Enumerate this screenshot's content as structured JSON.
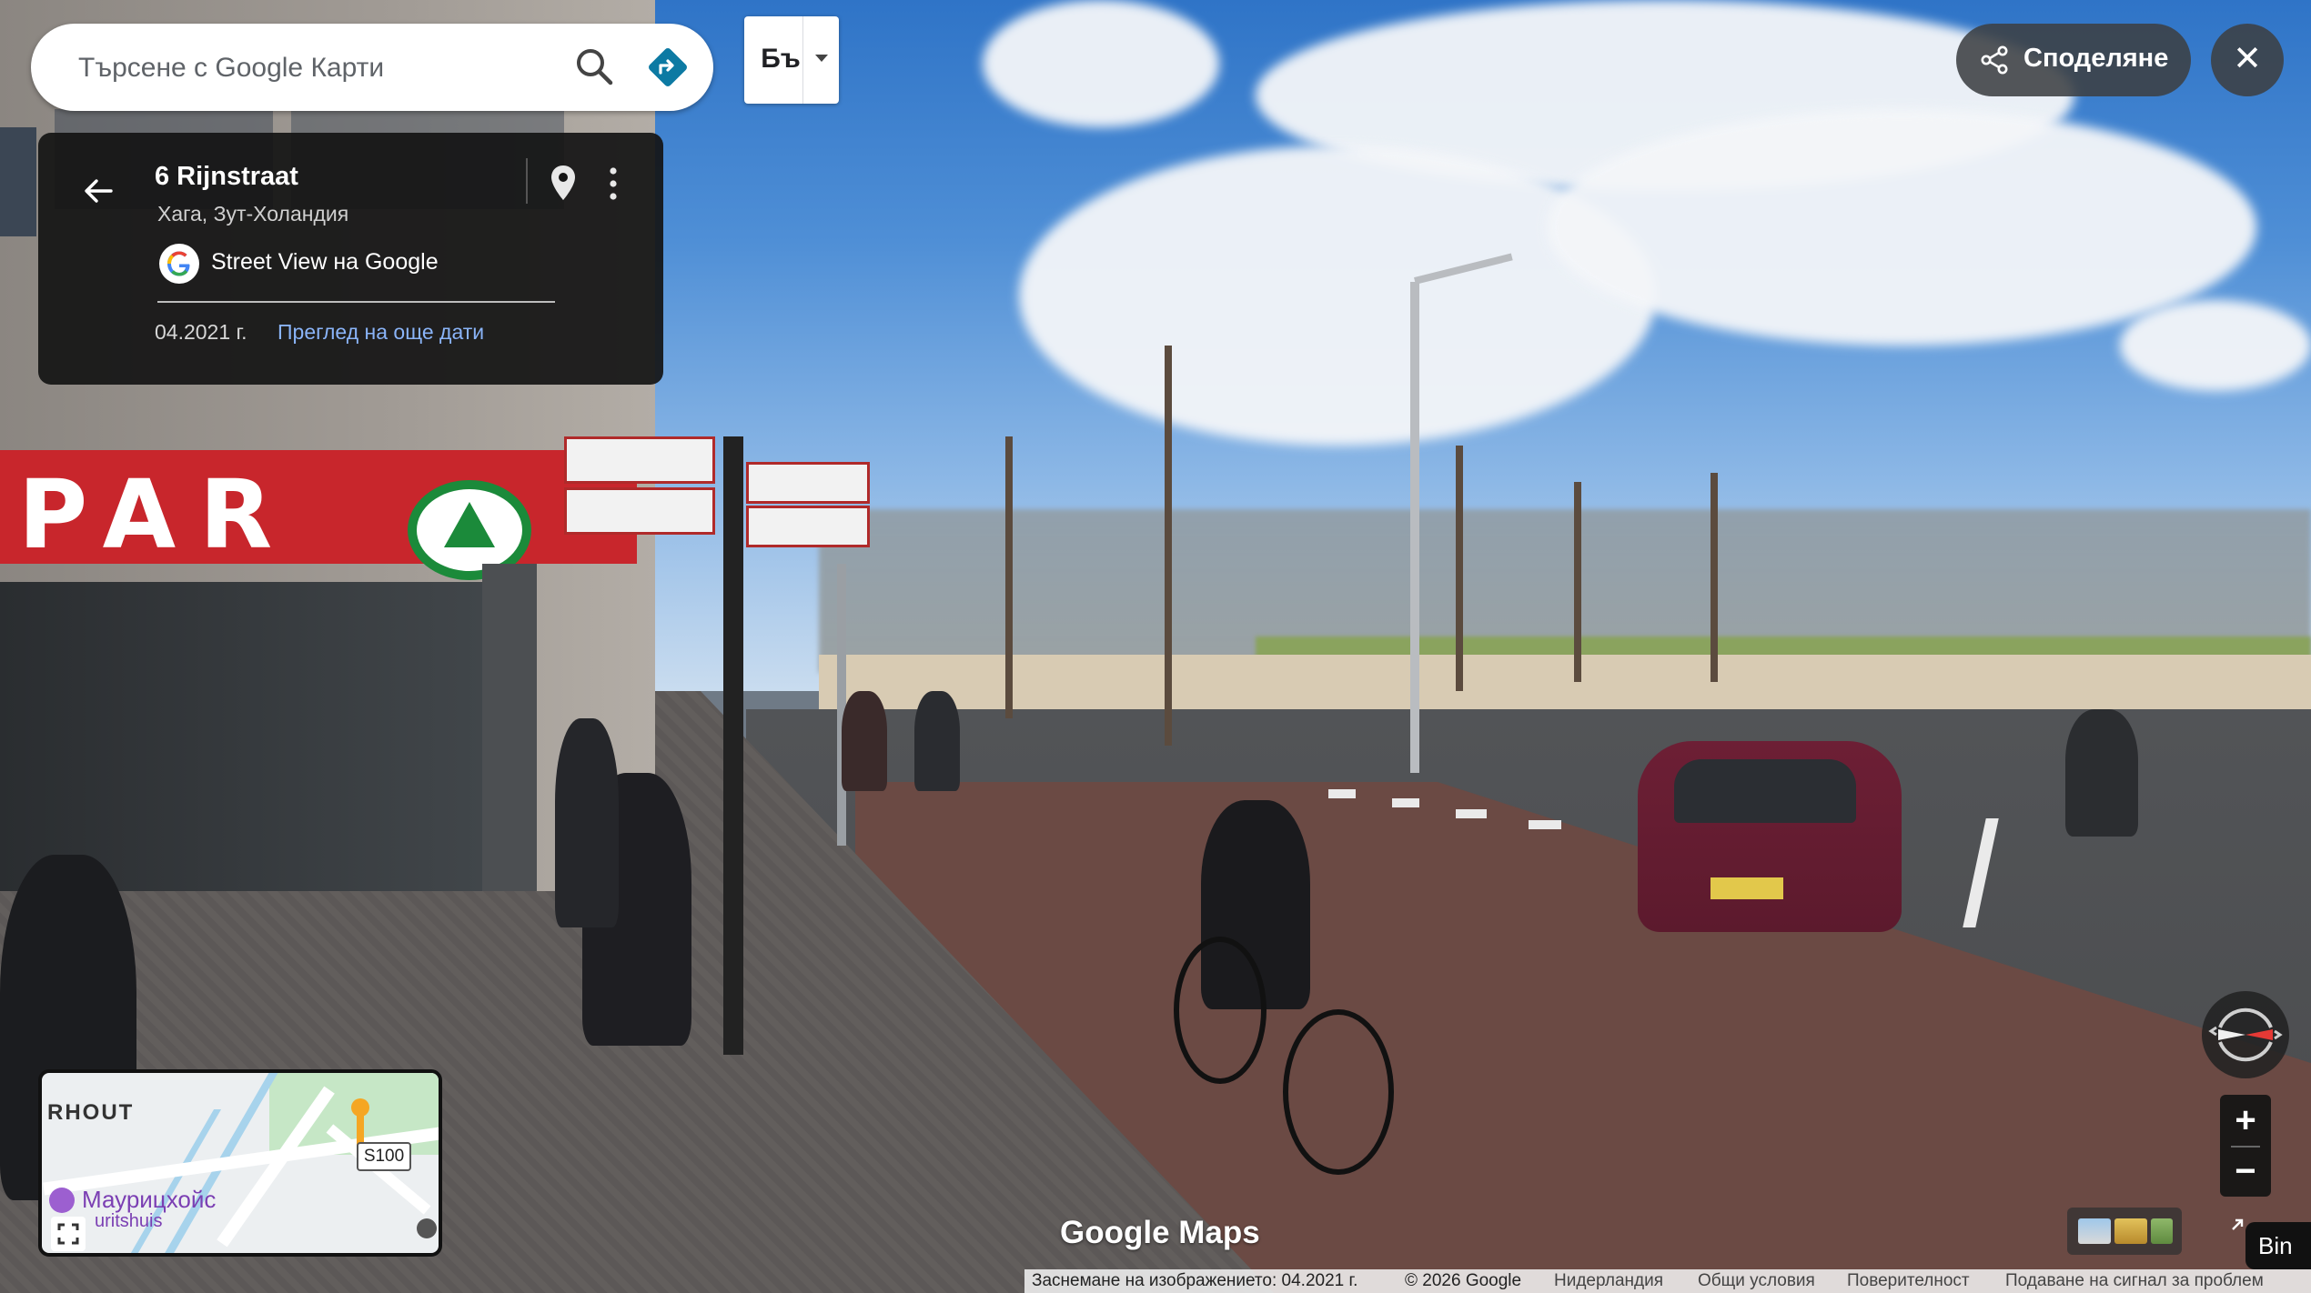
{
  "search": {
    "placeholder": "Търсене с Google Карти",
    "search_icon": "search-icon",
    "directions_icon": "directions-icon"
  },
  "language": {
    "label": "Бъ"
  },
  "panel": {
    "title": "6 Rijnstraat",
    "subtitle": "Хага, Зут-Холандия",
    "source_label": "Street View на Google",
    "date": "04.2021 г.",
    "more_dates": "Преглед на още дати"
  },
  "share": {
    "label": "Споделяне"
  },
  "close": {
    "label": "✕"
  },
  "zoom": {
    "in": "+",
    "out": "−"
  },
  "minimap": {
    "label_top": "RHOUT",
    "poi_name": "Маурицхойс",
    "poi_sub": "uritshuis",
    "route": "S100"
  },
  "branding": {
    "logo": "Google Maps"
  },
  "scene": {
    "shop_sign": "PAR"
  },
  "footer": {
    "capture": "Заснемане на изображението: 04.2021 г.",
    "copyright": "© 2026 Google",
    "country": "Нидерландия",
    "terms": "Общи условия",
    "privacy": "Поверителност",
    "report": "Подаване на сигнал за проблем"
  },
  "bing_tab": {
    "label": "Bin"
  },
  "colors": {
    "link": "#8ab4f8",
    "panel_bg": "#141414",
    "directions": "#1a73e8",
    "shop_red": "#c8262c",
    "spar_green": "#1b8a3a"
  }
}
